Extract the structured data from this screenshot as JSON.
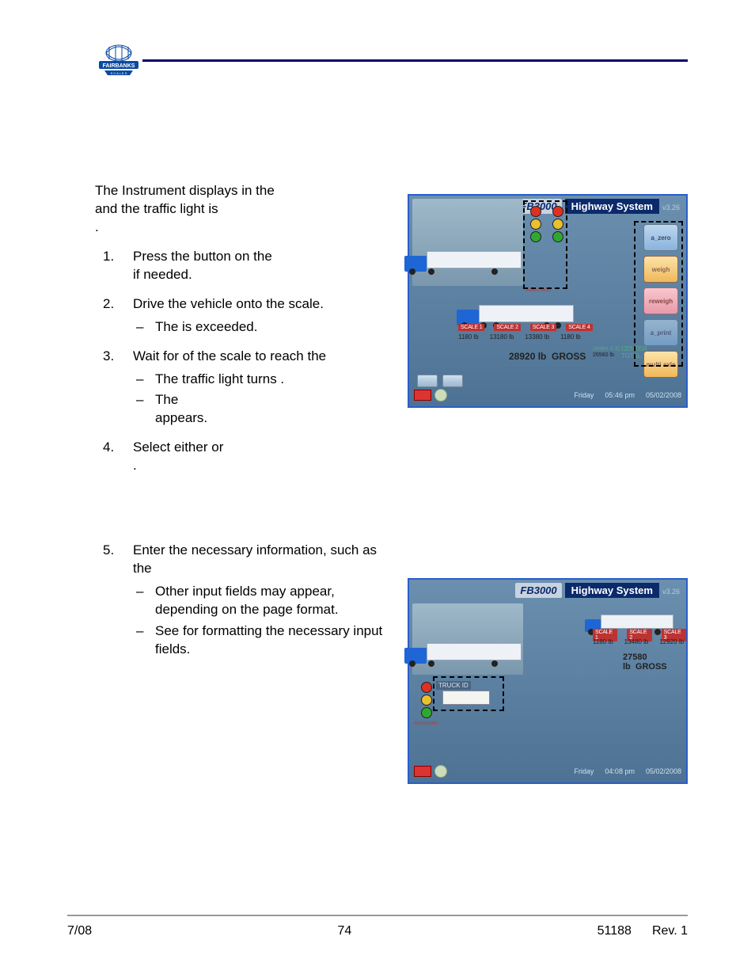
{
  "header": {
    "logo_text": "FAIRBANKS"
  },
  "intro": {
    "p1a": "The Instrument displays ",
    "p1b": " in the ",
    "p2a": " and the traffic light is ",
    "p2b": "."
  },
  "steps": [
    {
      "num": "1.",
      "a": "Press the ",
      "b": " button on the ",
      "c": " if needed."
    },
    {
      "num": "2.",
      "a": "Drive the vehicle onto the scale.",
      "sub": [
        {
          "a": "The ",
          "b": " is exceeded."
        }
      ]
    },
    {
      "num": "3.",
      "a": "Wait for ",
      "b": " of the scale to reach the ",
      "sub": [
        {
          "a": "The traffic light turns ",
          "b": "."
        },
        {
          "a": "The ",
          "b": " appears."
        }
      ]
    },
    {
      "num": "4.",
      "a": "Select either ",
      "b": " or ",
      "c": "."
    },
    {
      "num": "5.",
      "a": "Enter the necessary information, such as the ",
      "sub": [
        {
          "a": "Other input fields may appear, depending on the page format."
        },
        {
          "a": "See ",
          "b": " for formatting the necessary input fields."
        }
      ]
    }
  ],
  "img1": {
    "fb": "FB3000",
    "hs": "Highway System",
    "ver": "v3.26",
    "scale_labels": [
      "SCALE 1",
      "SCALE 2",
      "SCALE 3",
      "SCALE 4"
    ],
    "weights": [
      "1180 lb",
      "13180 lb",
      "13380 lb",
      "1180 lb"
    ],
    "gross_val": "28920 lb",
    "gross_lbl": "GROSS",
    "center_val": "26560 lb",
    "center_lbl1": "CENTER",
    "center_lbl2": "TOTAL",
    "axles_lbl": "(Axles 2-3)",
    "btns": {
      "zero": "a_zero",
      "weigh": "weigh",
      "reweigh": "reweigh",
      "print": "a_print",
      "multi": "multi axle"
    },
    "auto": "Automatic",
    "foot": {
      "day": "Friday",
      "time": "05:46 pm",
      "date": "05/02/2008"
    }
  },
  "img2": {
    "fb": "FB3000",
    "hs": "Highway System",
    "ver": "v3.26",
    "scale_labels": [
      "SCALE 1",
      "SCALE 2",
      "SCALE 3"
    ],
    "weights": [
      "1180 lb",
      "13480 lb",
      "12920 lb"
    ],
    "gross_val": "27580 lb",
    "gross_lbl": "GROSS",
    "truck_id": "TRUCK ID",
    "auto": "Automatic",
    "foot": {
      "day": "Friday",
      "time": "04:08 pm",
      "date": "05/02/2008"
    }
  },
  "footer": {
    "left": "7/08",
    "center": "74",
    "right_a": "51188",
    "right_b": "Rev. 1"
  }
}
